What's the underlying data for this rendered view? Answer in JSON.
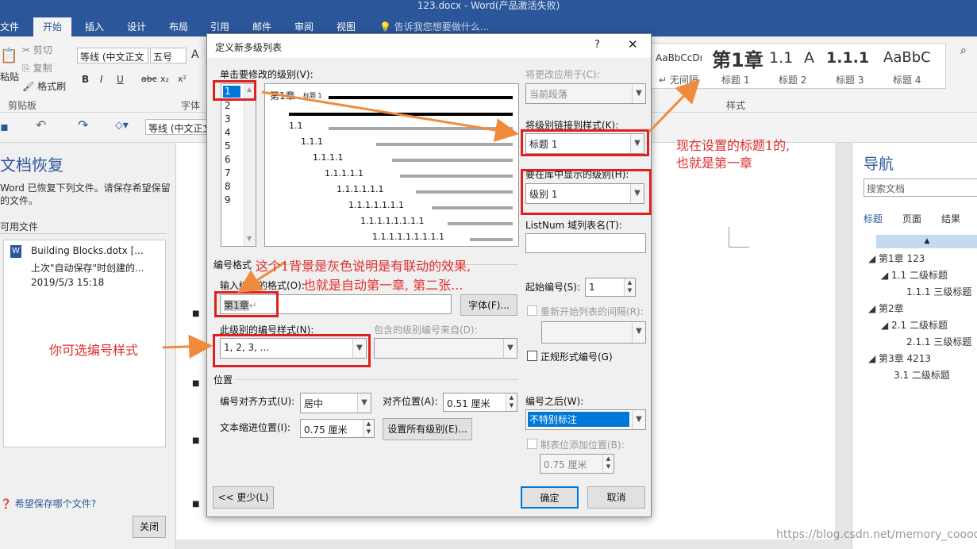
{
  "window": {
    "title": "123.docx - Word(产品激活失败)"
  },
  "tabs": [
    "文件",
    "开始",
    "插入",
    "设计",
    "布局",
    "引用",
    "邮件",
    "审阅",
    "视图"
  ],
  "tell_me": "告诉我您想要做什么...",
  "ribbon": {
    "cut": "剪切",
    "copy": "复制",
    "format_painter": "格式刷",
    "paste": "粘贴",
    "clipboard_group": "剪贴板",
    "font_name": "等线 (中文正文",
    "font_size": "五号",
    "font_group": "字体",
    "styles_group": "样式",
    "styles": [
      {
        "preview": "AaBbCcDı",
        "name": "无间隔"
      },
      {
        "preview": "第1章",
        "name": "标题 1"
      },
      {
        "preview": "1.1",
        "name": "标题 2"
      },
      {
        "preview": "A",
        "name": ""
      },
      {
        "preview": "1.1.1",
        "name": "标题 3"
      },
      {
        "preview": "AaBbC",
        "name": "标题 4"
      }
    ]
  },
  "qat": {
    "font_name": "等线 (中文正文"
  },
  "recovery": {
    "title": "文档恢复",
    "desc1": "Word 已恢复下列文件。请保存希望保留",
    "desc2": "的文件。",
    "available": "可用文件",
    "file_name": "Building Blocks.dotx [...",
    "file_sub": "上次\"自动保存\"时创建的...",
    "file_date": "2019/5/3 15:18",
    "question": "希望保存哪个文件?",
    "close": "关闭"
  },
  "nav": {
    "title": "导航",
    "search": "搜索文档",
    "tabs": [
      "标题",
      "页面",
      "结果"
    ],
    "items": [
      "第1章 123",
      "1.1 二级标题",
      "1.1.1 三级标题",
      "第2章",
      "2.1 二级标题",
      "2.1.1 三级标题",
      "第3章 4213",
      "3.1 二级标题"
    ]
  },
  "dialog": {
    "title": "定义新多级列表",
    "help": "?",
    "level_label": "单击要修改的级别(V):",
    "levels": [
      "1",
      "2",
      "3",
      "4",
      "5",
      "6",
      "7",
      "8",
      "9"
    ],
    "preview": {
      "first": "第1章",
      "first_tag": "标题 1",
      "rows": [
        "1.1",
        "1.1.1",
        "1.1.1.1",
        "1.1.1.1.1",
        "1.1.1.1.1.1",
        "1.1.1.1.1.1.1",
        "1.1.1.1.1.1.1.1",
        "1.1.1.1.1.1.1.1.1"
      ]
    },
    "apply_label": "将更改应用于(C):",
    "apply_value": "当前段落",
    "link_label": "将级别链接到样式(K):",
    "link_value": "标题 1",
    "gallery_label": "要在库中显示的级别(H):",
    "gallery_value": "级别 1",
    "listnum_label": "ListNum 域列表名(T):",
    "format_section": "编号格式",
    "enter_format_label": "输入编号的格式(O):",
    "format_value": "第1章",
    "font_button": "字体(F)...",
    "style_label": "此级别的编号样式(N):",
    "style_value": "1, 2, 3, ...",
    "include_label": "包含的级别编号来自(D):",
    "start_label": "起始编号(S):",
    "start_value": "1",
    "restart_label": "重新开始列表的间隔(R):",
    "legal_label": "正规形式编号(G)",
    "position_section": "位置",
    "align_label": "编号对齐方式(U):",
    "align_value": "居中",
    "at_label": "对齐位置(A):",
    "at_value": "0.51 厘米",
    "indent_label": "文本缩进位置(I):",
    "indent_value": "0.75 厘米",
    "set_all": "设置所有级别(E)...",
    "follow_label": "编号之后(W):",
    "follow_value": "不特别标注",
    "tab_label": "制表位添加位置(B):",
    "tab_value": "0.75 厘米",
    "less": "<< 更少(L)",
    "ok": "确定",
    "cancel": "取消"
  },
  "annotations": {
    "a1_line1": "现在设置的标题1的,",
    "a1_line2": "也就是第一章",
    "a2_line1": "这个1背景是灰色说明是有联动的效果,",
    "a2_line2": "也就是自动第一章, 第二张...",
    "a3": "你可选编号样式"
  },
  "watermark": "https://blog.csdn.net/memory_coood",
  "colors": {
    "word_blue": "#2b579a",
    "annotation_red": "#e03030",
    "arrow_orange": "#f08a3c"
  }
}
